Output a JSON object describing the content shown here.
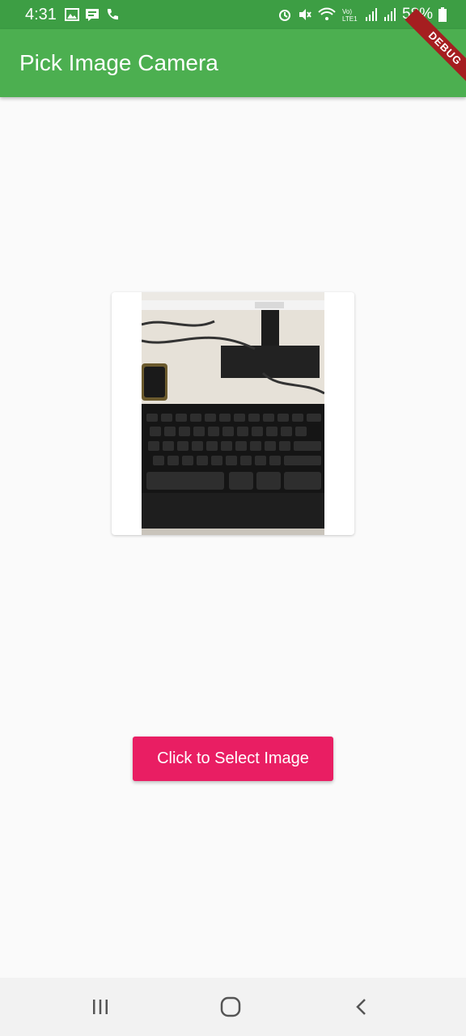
{
  "status_bar": {
    "time": "4:31",
    "battery": "58%",
    "left_icons": [
      "gallery-icon",
      "message-icon",
      "call-icon"
    ],
    "right_icons": [
      "alarm-icon",
      "mute-icon",
      "wifi-icon",
      "volte-icon",
      "signal-icon",
      "signal-icon",
      "battery-icon"
    ]
  },
  "app_bar": {
    "title": "Pick Image Camera",
    "debug_banner": "DEBUG",
    "color": "#4caf50"
  },
  "main": {
    "image_alt": "captured photo of keyboard and monitor",
    "button_label": "Click to Select Image",
    "button_color": "#e91e63"
  },
  "nav_bar": {
    "buttons": [
      "recent-apps-icon",
      "home-icon",
      "back-icon"
    ]
  }
}
